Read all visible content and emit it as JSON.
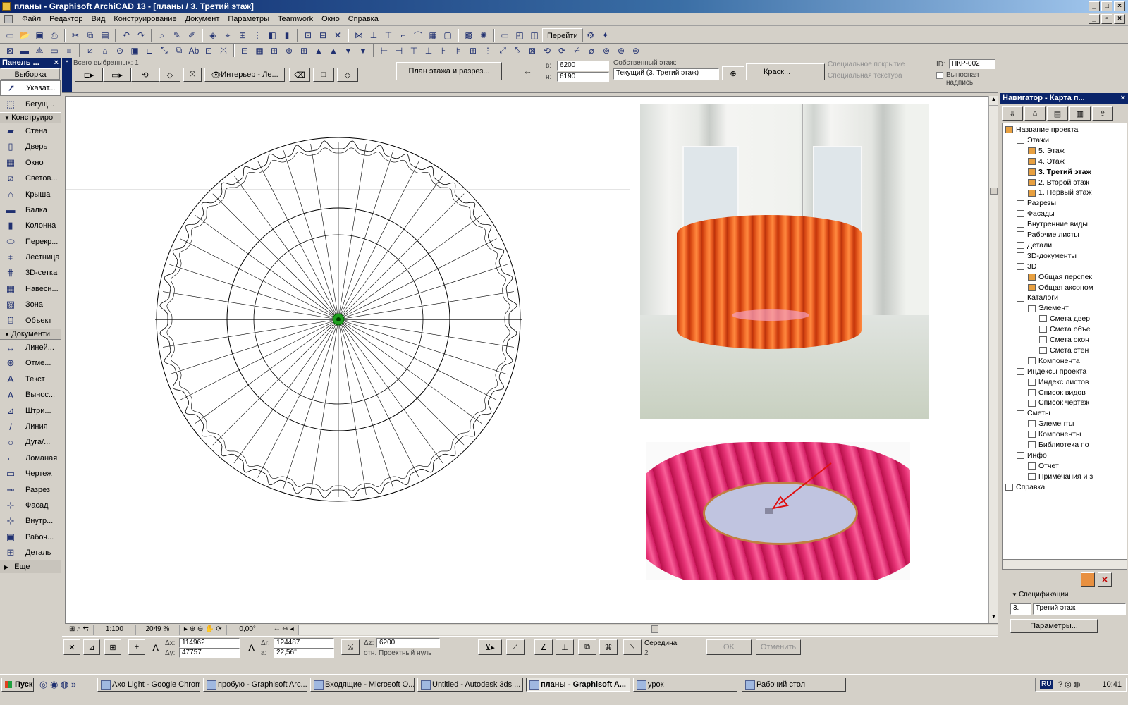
{
  "window": {
    "title": "планы - Graphisoft ArchiCAD 13 - [планы / 3. Третий этаж]"
  },
  "menu": [
    "Файл",
    "Редактор",
    "Вид",
    "Конструирование",
    "Документ",
    "Параметры",
    "Teamwork",
    "Окно",
    "Справка"
  ],
  "toolbar": {
    "goto_label": "Перейти"
  },
  "toolbox": {
    "title": "Панель ...",
    "select_label": "Выборка",
    "arrow": "Указат...",
    "marquee": "Бегущ...",
    "group_design": "Конструиро",
    "design": [
      "Стена",
      "Дверь",
      "Окно",
      "Светов...",
      "Крыша",
      "Балка",
      "Колонна",
      "Перекр...",
      "Лестница",
      "3D-сетка",
      "Навесн...",
      "Зона",
      "Объект"
    ],
    "group_doc": "Документи",
    "doc": [
      "Линей...",
      "Отме...",
      "Текст",
      "Вынос...",
      "Штри...",
      "Линия",
      "Дуга/...",
      "Ломаная",
      "Чертеж",
      "Разрез",
      "Фасад",
      "Внутр...",
      "Рабоч...",
      "Деталь"
    ],
    "more": "Еще"
  },
  "infobox": {
    "selected": "Всего выбранных: 1",
    "style": "Интерьер - Ле...",
    "floorplan_btn": "План этажа и разрез...",
    "dim_a": "6200",
    "dim_b": "6190",
    "own_floor_label": "Собственный этаж:",
    "floor_value": "Текущий (3. Третий этаж)",
    "paint": "Краск...",
    "special_cover": "Специальное покрытие",
    "special_texture": "Специальная текстура",
    "id_label": "ID:",
    "id_value": "ПКР-002",
    "callout": "Выносная надпись"
  },
  "status": {
    "scale": "1:100",
    "zoom": "2049 %",
    "angle": "0,00°"
  },
  "coords": {
    "dx_label": "Δx:",
    "dx": "114962",
    "dy_label": "Δy:",
    "dy": "47757",
    "dr_label": "Δr:",
    "dr": "124487",
    "a_label": "a:",
    "a": "22,56°",
    "dz_label": "Δz:",
    "dz": "6200",
    "ref": "отн. Проектный нуль",
    "snap": "Середина",
    "snap_n": "2",
    "ok": "OK",
    "cancel": "Отменить"
  },
  "navigator": {
    "title": "Навигатор - Карта п...",
    "tree": [
      {
        "label": "Название проекта",
        "d": 0,
        "t": "fold"
      },
      {
        "label": "Этажи",
        "d": 1,
        "t": "doc"
      },
      {
        "label": "5. Этаж",
        "d": 2,
        "t": "fold"
      },
      {
        "label": "4. Этаж",
        "d": 2,
        "t": "fold"
      },
      {
        "label": "3. Третий этаж",
        "d": 2,
        "t": "fold",
        "bold": true
      },
      {
        "label": "2. Второй этаж",
        "d": 2,
        "t": "fold"
      },
      {
        "label": "1. Первый этаж",
        "d": 2,
        "t": "fold"
      },
      {
        "label": "Разрезы",
        "d": 1,
        "t": "doc"
      },
      {
        "label": "Фасады",
        "d": 1,
        "t": "doc"
      },
      {
        "label": "Внутренние виды",
        "d": 1,
        "t": "doc"
      },
      {
        "label": "Рабочие листы",
        "d": 1,
        "t": "doc"
      },
      {
        "label": "Детали",
        "d": 1,
        "t": "doc"
      },
      {
        "label": "3D-документы",
        "d": 1,
        "t": "doc"
      },
      {
        "label": "3D",
        "d": 1,
        "t": "doc"
      },
      {
        "label": "Общая перспек",
        "d": 2,
        "t": "fold"
      },
      {
        "label": "Общая аксоном",
        "d": 2,
        "t": "fold"
      },
      {
        "label": "Каталоги",
        "d": 1,
        "t": "doc"
      },
      {
        "label": "Элемент",
        "d": 2,
        "t": "doc"
      },
      {
        "label": "Смета двер",
        "d": 3,
        "t": "doc"
      },
      {
        "label": "Смета объе",
        "d": 3,
        "t": "doc"
      },
      {
        "label": "Смета окон",
        "d": 3,
        "t": "doc"
      },
      {
        "label": "Смета стен",
        "d": 3,
        "t": "doc"
      },
      {
        "label": "Компонента",
        "d": 2,
        "t": "doc"
      },
      {
        "label": "Индексы проекта",
        "d": 1,
        "t": "doc"
      },
      {
        "label": "Индекс листов",
        "d": 2,
        "t": "doc"
      },
      {
        "label": "Список видов",
        "d": 2,
        "t": "doc"
      },
      {
        "label": "Список чертеж",
        "d": 2,
        "t": "doc"
      },
      {
        "label": "Сметы",
        "d": 1,
        "t": "doc"
      },
      {
        "label": "Элементы",
        "d": 2,
        "t": "doc"
      },
      {
        "label": "Компоненты",
        "d": 2,
        "t": "doc"
      },
      {
        "label": "Библиотека по",
        "d": 2,
        "t": "doc"
      },
      {
        "label": "Инфо",
        "d": 1,
        "t": "doc"
      },
      {
        "label": "Отчет",
        "d": 2,
        "t": "doc"
      },
      {
        "label": "Примечания и з",
        "d": 2,
        "t": "doc"
      },
      {
        "label": "Справка",
        "d": 0,
        "t": "doc"
      }
    ],
    "spec_label": "Спецификации",
    "spec_num": "3.",
    "spec_value": "Третий этаж",
    "params_btn": "Параметры..."
  },
  "taskbar": {
    "start": "Пуск",
    "tasks": [
      "Axo Light - Google Chrome",
      "пробую - Graphisoft Arc...",
      "Входящие - Microsoft O...",
      "Untitled - Autodesk 3ds ...",
      "планы - Graphisoft A...",
      "урок",
      "Рабочий стол"
    ],
    "lang": "RU",
    "clock": "10:41"
  },
  "colors": {
    "title_bg": "#0a246a",
    "shade_orange": "#e85a20",
    "shade_pink": "#d8206a"
  }
}
